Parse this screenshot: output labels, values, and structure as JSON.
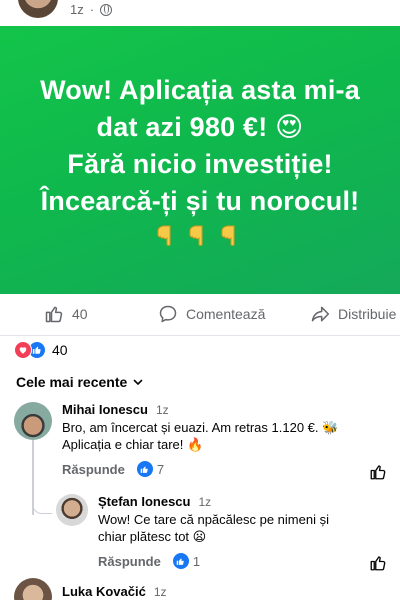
{
  "post": {
    "time": "1z",
    "banner_lines": [
      "Wow! Aplicația asta mi-a",
      "dat azi 980 €! 😍",
      "Fără nicio investiție!",
      "Încearcă-ți și tu norocul!"
    ],
    "banner_emoji_icons": [
      "pointing-down-icon",
      "pointing-down-icon",
      "pointing-down-icon"
    ],
    "banner_color": "#12bb4d"
  },
  "actions": {
    "like_count": "40",
    "comment_label": "Comentează",
    "share_label": "Distribuie"
  },
  "reactions": {
    "count": "40",
    "icons": [
      "heart-icon",
      "like-icon"
    ]
  },
  "sort": {
    "label": "Cele mai recente"
  },
  "comments": [
    {
      "name": "Mihai Ionescu",
      "time": "1z",
      "text_line1": "Bro, am încercat și euazi. Am retras 1.120 €. 🐝",
      "text_line2": "Aplicația e chiar tare! 🔥",
      "reply_label": "Răspunde",
      "likes": "7"
    },
    {
      "name": "Ștefan Ionescu",
      "time": "1z",
      "text_line1": "Wow! Ce tare că npăcălesc pe nimeni și",
      "text_line2": "chiar plătesc tot 😦",
      "reply_label": "Răspunde",
      "likes": "1"
    },
    {
      "name": "Luka Kovačić",
      "time": "1z"
    }
  ],
  "colors": {
    "accent": "#1877f2",
    "heart": "#f33e58",
    "muted_text": "#65676b"
  }
}
